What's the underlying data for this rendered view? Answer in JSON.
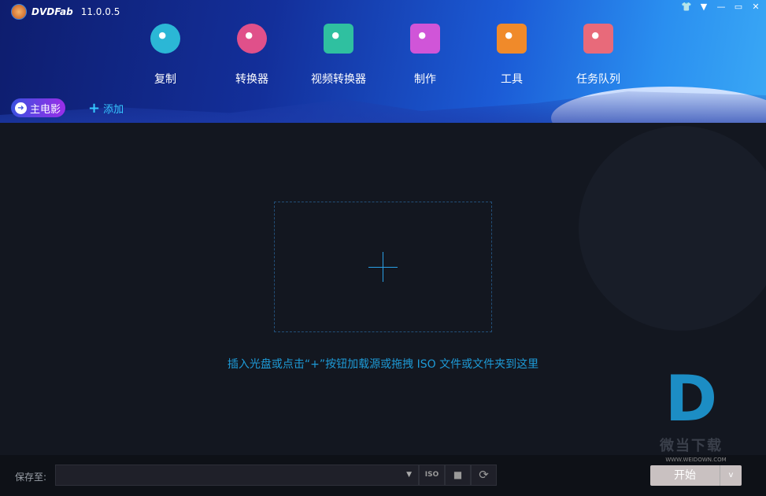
{
  "app": {
    "brand": "DVDFab",
    "version": "11.0.0.5"
  },
  "window_controls": [
    {
      "name": "skin-icon",
      "glyph": "👕"
    },
    {
      "name": "menu-icon",
      "glyph": "▼"
    },
    {
      "name": "minimize-icon",
      "glyph": "—"
    },
    {
      "name": "maximize-icon",
      "glyph": "▭"
    },
    {
      "name": "close-icon",
      "glyph": "✕"
    }
  ],
  "nav": [
    {
      "label": "复制",
      "icon": "copy-disc-icon",
      "color": "#2bb7d6"
    },
    {
      "label": "转换器",
      "icon": "ripper-disc-icon",
      "color": "#e0508a"
    },
    {
      "label": "视频转换器",
      "icon": "video-converter-icon",
      "color": "#2fc0a0"
    },
    {
      "label": "制作",
      "icon": "creator-icon",
      "color": "#d055d8"
    },
    {
      "label": "工具",
      "icon": "toolbox-icon",
      "color": "#f08a2a"
    },
    {
      "label": "任务队列",
      "icon": "task-queue-icon",
      "color": "#e86a7a"
    }
  ],
  "mode_chip": "主电影",
  "add_label": "添加",
  "drop_hint": "插入光盘或点击“+”按钮加载源或拖拽 ISO 文件或文件夹到这里",
  "watermark": {
    "letter": "D",
    "name": "微当下载",
    "url": "WWW.WEIDOWN.COM"
  },
  "footer": {
    "save_label": "保存至:",
    "path_value": "",
    "iso_label": "ISO",
    "start_label": "开始"
  },
  "colors": {
    "accent": "#1e9ad6",
    "start_button": "#c9c1c1"
  }
}
